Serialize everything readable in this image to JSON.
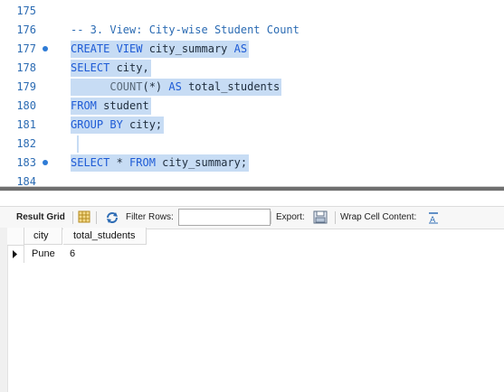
{
  "editor": {
    "lines": [
      {
        "num": "175",
        "marker": false,
        "selected": false,
        "tokens": []
      },
      {
        "num": "176",
        "marker": false,
        "selected": false,
        "tokens": [
          {
            "t": "-- 3. View: City-wise Student Count",
            "c": "cm"
          }
        ]
      },
      {
        "num": "177",
        "marker": true,
        "selected": true,
        "tokens": [
          {
            "t": "CREATE VIEW",
            "c": "kw"
          },
          {
            "t": " city_summary ",
            "c": "tx"
          },
          {
            "t": "AS",
            "c": "kw"
          }
        ]
      },
      {
        "num": "178",
        "marker": false,
        "selected": true,
        "tokens": [
          {
            "t": "SELECT",
            "c": "kw"
          },
          {
            "t": " city,",
            "c": "tx"
          }
        ]
      },
      {
        "num": "179",
        "marker": false,
        "selected": true,
        "tokens": [
          {
            "t": "      ",
            "c": "tx"
          },
          {
            "t": "COUNT",
            "c": "fn"
          },
          {
            "t": "(*) ",
            "c": "tx"
          },
          {
            "t": "AS",
            "c": "kw"
          },
          {
            "t": " total_students",
            "c": "tx"
          }
        ]
      },
      {
        "num": "180",
        "marker": false,
        "selected": true,
        "tokens": [
          {
            "t": "FROM",
            "c": "kw"
          },
          {
            "t": " student",
            "c": "tx"
          }
        ]
      },
      {
        "num": "181",
        "marker": false,
        "selected": true,
        "tokens": [
          {
            "t": "GROUP BY",
            "c": "kw"
          },
          {
            "t": " city;",
            "c": "tx"
          }
        ]
      },
      {
        "num": "182",
        "marker": false,
        "selected": false,
        "tokens": [],
        "cursor": true
      },
      {
        "num": "183",
        "marker": true,
        "selected": true,
        "tokens": [
          {
            "t": "SELECT",
            "c": "kw"
          },
          {
            "t": " * ",
            "c": "tx"
          },
          {
            "t": "FROM",
            "c": "kw"
          },
          {
            "t": " city_summary;",
            "c": "tx"
          }
        ]
      },
      {
        "num": "184",
        "marker": false,
        "selected": false,
        "tokens": []
      }
    ]
  },
  "toolbar": {
    "result_grid_label": "Result Grid",
    "filter_rows_label": "Filter Rows:",
    "filter_value": "",
    "export_label": "Export:",
    "wrap_label": "Wrap Cell Content:",
    "icons": [
      "grid-view-icon",
      "refresh-icon",
      "export-icon",
      "wrap-icon"
    ]
  },
  "grid": {
    "columns": [
      "city",
      "total_students"
    ],
    "rows": [
      [
        "Pune",
        "6"
      ]
    ]
  },
  "colors": {
    "keyword": "#1e5bd6",
    "selection": "#c7dcf4",
    "line_number": "#2b6bb3"
  }
}
